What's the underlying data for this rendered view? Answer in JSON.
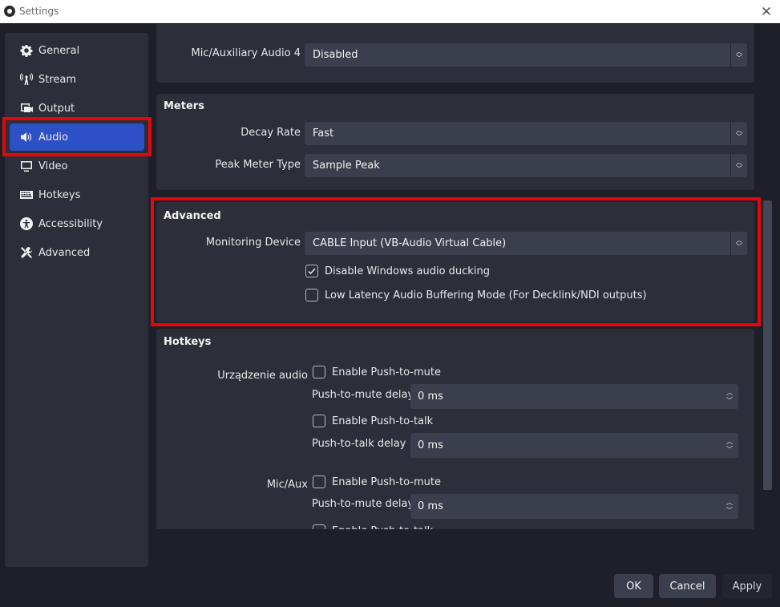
{
  "window": {
    "title": "Settings",
    "close_icon": "close-icon"
  },
  "sidebar": {
    "items": [
      {
        "label": "General",
        "icon": "gear-icon"
      },
      {
        "label": "Stream",
        "icon": "antenna-icon"
      },
      {
        "label": "Output",
        "icon": "output-icon"
      },
      {
        "label": "Audio",
        "icon": "speaker-icon",
        "active": true
      },
      {
        "label": "Video",
        "icon": "monitor-icon"
      },
      {
        "label": "Hotkeys",
        "icon": "keyboard-icon"
      },
      {
        "label": "Accessibility",
        "icon": "accessibility-icon"
      },
      {
        "label": "Advanced",
        "icon": "tools-icon"
      }
    ]
  },
  "devices": {
    "mic_aux_4": {
      "label": "Mic/Auxiliary Audio 4",
      "value": "Disabled"
    }
  },
  "meters": {
    "title": "Meters",
    "decay_rate": {
      "label": "Decay Rate",
      "value": "Fast"
    },
    "peak_meter_type": {
      "label": "Peak Meter Type",
      "value": "Sample Peak"
    }
  },
  "advanced": {
    "title": "Advanced",
    "monitoring_device": {
      "label": "Monitoring Device",
      "value": "CABLE Input (VB-Audio Virtual Cable)"
    },
    "disable_ducking": {
      "label": "Disable Windows audio ducking",
      "checked": true
    },
    "low_latency": {
      "label": "Low Latency Audio Buffering Mode (For Decklink/NDI outputs)",
      "checked": false
    }
  },
  "hotkeys": {
    "title": "Hotkeys",
    "sources": [
      {
        "name": "Urządzenie audio",
        "push_to_mute": {
          "label": "Enable Push-to-mute",
          "checked": false
        },
        "push_to_mute_delay": {
          "label": "Push-to-mute delay",
          "value": "0 ms"
        },
        "push_to_talk": {
          "label": "Enable Push-to-talk",
          "checked": false
        },
        "push_to_talk_delay": {
          "label": "Push-to-talk delay",
          "value": "0 ms"
        }
      },
      {
        "name": "Mic/Aux",
        "push_to_mute": {
          "label": "Enable Push-to-mute",
          "checked": false
        },
        "push_to_mute_delay": {
          "label": "Push-to-mute delay",
          "value": "0 ms"
        },
        "push_to_talk": {
          "label": "Enable Push-to-talk",
          "checked": false
        }
      }
    ]
  },
  "footer": {
    "ok": "OK",
    "cancel": "Cancel",
    "apply": "Apply"
  },
  "colors": {
    "accent": "#2d50c6",
    "highlight": "#e5060c",
    "background": "#1e1f29",
    "panel": "#2c2e3a",
    "input": "#3b3e4c"
  }
}
